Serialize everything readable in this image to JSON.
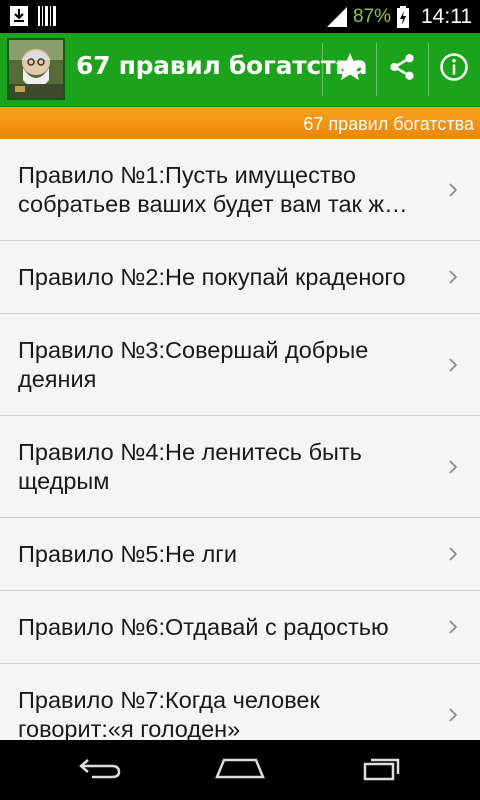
{
  "status_bar": {
    "battery_percent": "87%",
    "time": "14:11",
    "icons": [
      "download-icon",
      "barcode-icon",
      "signal-icon",
      "battery-icon"
    ]
  },
  "action_bar": {
    "title": "67 правил богатства",
    "icons": [
      "star-icon",
      "share-icon",
      "info-icon"
    ],
    "color": "#1ba31b"
  },
  "sub_bar": {
    "text": "67 правил богатства",
    "color": "#f39313"
  },
  "list": {
    "items": [
      {
        "label": "Правило №1:Пусть имущество собратьев ваших будет вам так ж…"
      },
      {
        "label": "Правило №2:Не покупай краденого"
      },
      {
        "label": "Правило №3:Совершай добрые деяния"
      },
      {
        "label": "Правило №4:Не ленитесь быть щедрым"
      },
      {
        "label": "Правило №5:Не лги"
      },
      {
        "label": "Правило №6:Отдавай с радостью"
      },
      {
        "label": "Правило №7:Когда человек говорит:«я голоден»"
      }
    ]
  },
  "nav_bar": {
    "icons": [
      "back-icon",
      "home-icon",
      "recent-apps-icon"
    ]
  }
}
